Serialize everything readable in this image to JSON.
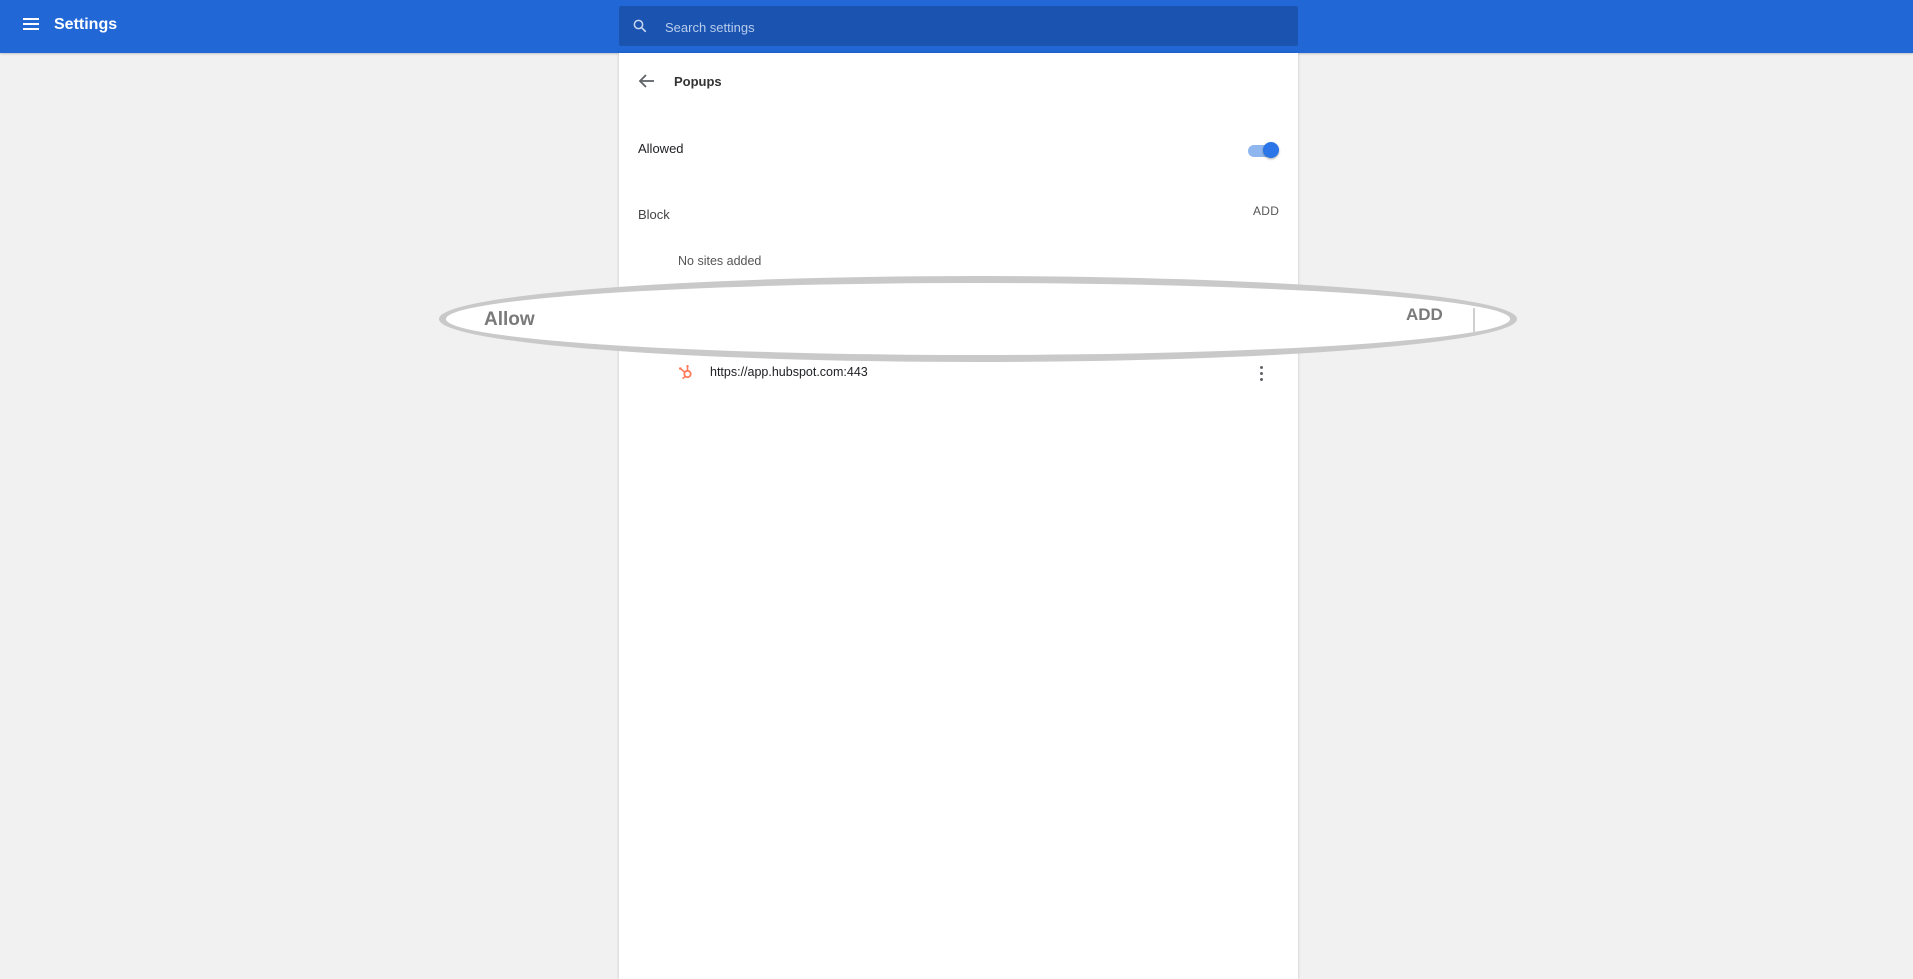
{
  "header": {
    "title": "Settings",
    "menu_icon": "hamburger-menu-icon",
    "search": {
      "icon": "search-icon",
      "placeholder": "Search settings",
      "value": ""
    },
    "color": "#2168d6"
  },
  "page": {
    "title": "Popups",
    "back_icon": "arrow-back-icon",
    "allowed": {
      "label": "Allowed",
      "toggle_on": true
    },
    "block": {
      "label": "Block",
      "add_label": "ADD",
      "empty_text": "No sites added"
    },
    "allow": {
      "label": "Allow",
      "add_label": "ADD",
      "sites": [
        {
          "url": "https://app.hubspot.com:443",
          "icon": "hubspot-icon",
          "more_icon": "more-vert-icon"
        }
      ]
    }
  },
  "colors": {
    "accent": "#2a75e8",
    "hubspot": "#ff7a59"
  }
}
